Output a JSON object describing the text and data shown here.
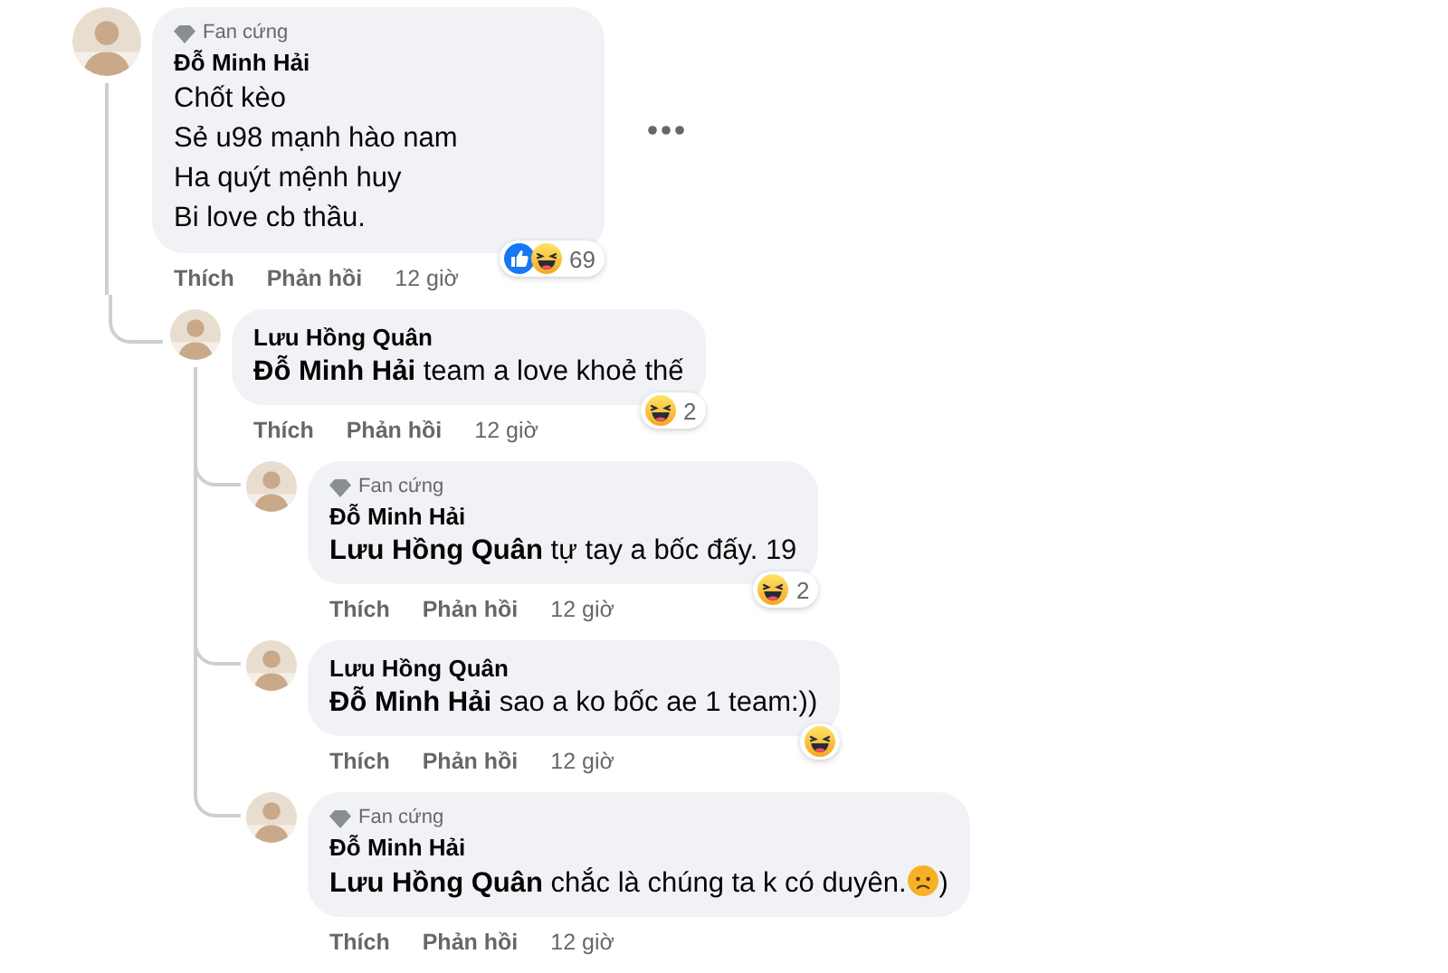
{
  "comments": [
    {
      "author": "Đỗ Minh Hải",
      "badge": "Fan cứng",
      "lines": [
        "Chốt kèo",
        "Sẻ u98 mạnh hào nam",
        "Ha quýt mệnh huy",
        "Bi love cb thầu."
      ],
      "reactions": {
        "types": [
          {
            "kind": "like"
          },
          {
            "kind": "haha"
          }
        ],
        "count": "69"
      },
      "actions": [
        "Thích",
        "Phản hồi"
      ],
      "time": "12 giờ",
      "menu": true,
      "replies": [
        {
          "author": "Lưu Hồng Quân",
          "lines": [
            "**Đỗ Minh Hải** team a love khoẻ thế"
          ],
          "reactions": {
            "types": [
              {
                "kind": "haha"
              }
            ],
            "count": "2"
          },
          "actions": [
            "Thích",
            "Phản hồi"
          ],
          "time": "12 giờ",
          "replies": [
            {
              "author": "Đỗ Minh Hải",
              "badge": "Fan cứng",
              "lines": [
                "**Lưu Hồng Quân** tự tay a bốc đấy. 19"
              ],
              "reactions": {
                "types": [
                  {
                    "kind": "haha"
                  }
                ],
                "count": "2"
              },
              "actions": [
                "Thích",
                "Phản hồi"
              ],
              "time": "12 giờ"
            },
            {
              "author": "Lưu Hồng Quân",
              "lines": [
                "**Đỗ Minh Hải** sao a ko bốc ae 1 team:))"
              ],
              "reactions": {
                "types": [
                  {
                    "kind": "haha"
                  }
                ]
              },
              "actions": [
                "Thích",
                "Phản hồi"
              ],
              "time": "12 giờ"
            },
            {
              "author": "Đỗ Minh Hải",
              "badge": "Fan cứng",
              "lines": [
                "**Lưu Hồng Quân** chắc là chúng ta k có duyên."
              ],
              "inline_emoji": {
                "kind": "sad"
              },
              "text_after": ")",
              "actions": [
                "Thích",
                "Phản hồi"
              ],
              "time": "12 giờ"
            }
          ]
        }
      ]
    }
  ]
}
